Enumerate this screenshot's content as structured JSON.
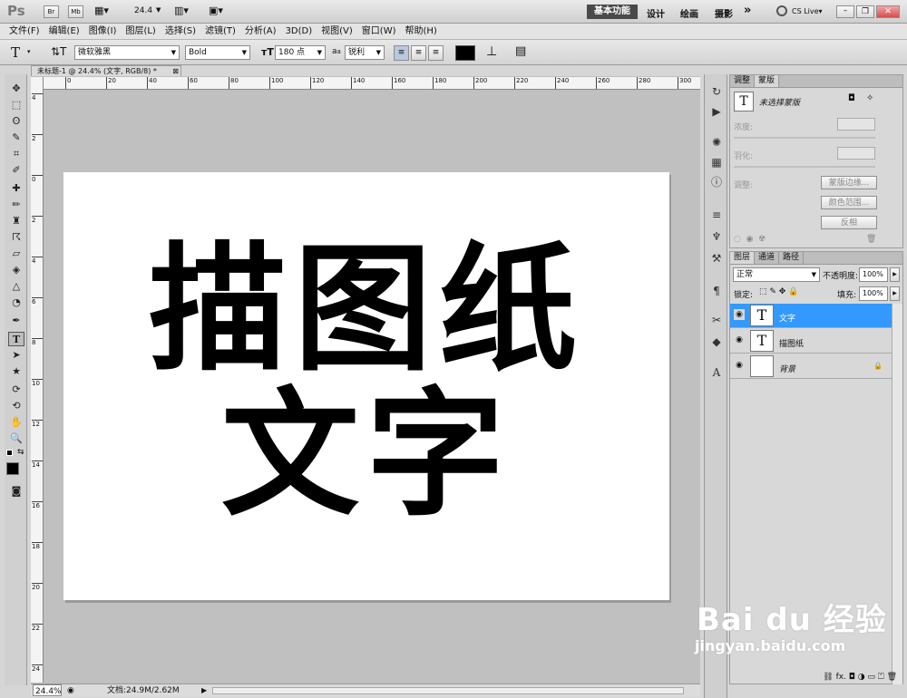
{
  "app": {
    "logo": "Ps",
    "zoom": "24.4",
    "workspace_active": "基本功能",
    "workspaces": [
      "设计",
      "绘画",
      "摄影"
    ],
    "more": "»",
    "cslive": "CS Live▾"
  },
  "menu": [
    "文件(F)",
    "编辑(E)",
    "图像(I)",
    "图层(L)",
    "选择(S)",
    "滤镜(T)",
    "分析(A)",
    "3D(D)",
    "视图(V)",
    "窗口(W)",
    "帮助(H)"
  ],
  "options": {
    "font_family": "微软雅黑",
    "font_style": "Bold",
    "font_size": "180 点",
    "aa_label": "a",
    "antialias": "锐利",
    "color": "#000000"
  },
  "document": {
    "tab_title": "未标题-1 @ 24.4% (文字, RGB/8) *",
    "line1": "描图纸",
    "line2": "文字"
  },
  "ruler": {
    "h_ticks": [
      "0",
      "20",
      "40",
      "60",
      "80",
      "100",
      "120",
      "140",
      "160",
      "180",
      "200",
      "220",
      "240",
      "260",
      "280",
      "300"
    ],
    "v_ticks": [
      "4",
      "2",
      "0",
      "2",
      "4",
      "6",
      "8",
      "10",
      "12",
      "14",
      "16",
      "18",
      "20",
      "22",
      "24"
    ]
  },
  "status": {
    "zoom": "24.4%",
    "doc": "文档:24.9M/2.62M"
  },
  "masks": {
    "tabs": [
      "调整",
      "蒙版"
    ],
    "title": "未选择蒙版",
    "density": "浓度:",
    "feather": "羽化:",
    "refine": "调整:",
    "btn_edge": "蒙版边缘...",
    "btn_range": "颜色范围...",
    "btn_invert": "反相"
  },
  "layers": {
    "tabs": [
      "图层",
      "通道",
      "路径"
    ],
    "blend": "正常",
    "opacity_label": "不透明度:",
    "opacity": "100%",
    "lock_label": "锁定:",
    "fill_label": "填充:",
    "fill": "100%",
    "items": [
      {
        "name": "文字",
        "selected": true
      },
      {
        "name": "描图纸",
        "selected": false
      },
      {
        "name": "背景",
        "selected": false
      }
    ]
  },
  "watermark": {
    "brand": "Bai du 经验",
    "url": "jingyan.baidu.com"
  },
  "colors": {
    "selection": "#3399ff",
    "fg": "#000000",
    "bg": "#ffffff"
  }
}
